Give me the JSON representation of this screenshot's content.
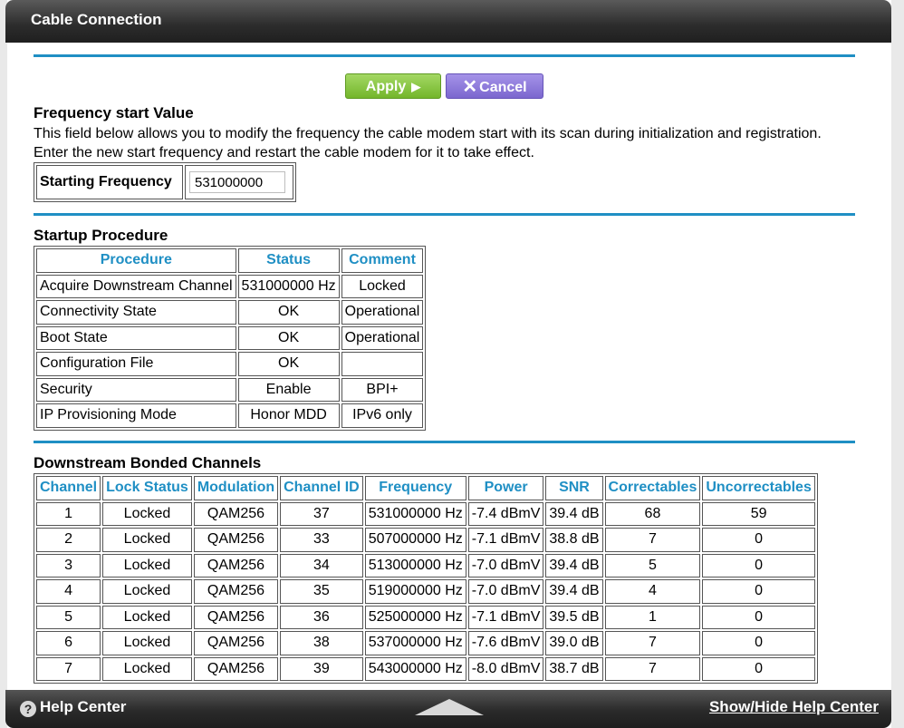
{
  "window": {
    "title": "Cable Connection"
  },
  "buttons": {
    "apply": "Apply",
    "cancel": "Cancel"
  },
  "frequency": {
    "heading": "Frequency start Value",
    "description": "This field below allows you to modify the frequency the cable modem start with its scan during initialization and registration. Enter the new start frequency and restart the cable modem for it to take effect.",
    "label": "Starting Frequency",
    "value": "531000000"
  },
  "startup": {
    "heading": "Startup Procedure",
    "columns": [
      "Procedure",
      "Status",
      "Comment"
    ],
    "rows": [
      [
        "Acquire Downstream Channel",
        "531000000 Hz",
        "Locked"
      ],
      [
        "Connectivity State",
        "OK",
        "Operational"
      ],
      [
        "Boot State",
        "OK",
        "Operational"
      ],
      [
        "Configuration File",
        "OK",
        ""
      ],
      [
        "Security",
        "Enable",
        "BPI+"
      ],
      [
        "IP Provisioning Mode",
        "Honor MDD",
        "IPv6 only"
      ]
    ]
  },
  "downstream": {
    "heading": "Downstream Bonded Channels",
    "columns": [
      "Channel",
      "Lock Status",
      "Modulation",
      "Channel ID",
      "Frequency",
      "Power",
      "SNR",
      "Correctables",
      "Uncorrectables"
    ],
    "rows": [
      [
        "1",
        "Locked",
        "QAM256",
        "37",
        "531000000 Hz",
        "-7.4 dBmV",
        "39.4 dB",
        "68",
        "59"
      ],
      [
        "2",
        "Locked",
        "QAM256",
        "33",
        "507000000 Hz",
        "-7.1 dBmV",
        "38.8 dB",
        "7",
        "0"
      ],
      [
        "3",
        "Locked",
        "QAM256",
        "34",
        "513000000 Hz",
        "-7.0 dBmV",
        "39.4 dB",
        "5",
        "0"
      ],
      [
        "4",
        "Locked",
        "QAM256",
        "35",
        "519000000 Hz",
        "-7.0 dBmV",
        "39.4 dB",
        "4",
        "0"
      ],
      [
        "5",
        "Locked",
        "QAM256",
        "36",
        "525000000 Hz",
        "-7.1 dBmV",
        "39.5 dB",
        "1",
        "0"
      ],
      [
        "6",
        "Locked",
        "QAM256",
        "38",
        "537000000 Hz",
        "-7.6 dBmV",
        "39.0 dB",
        "7",
        "0"
      ],
      [
        "7",
        "Locked",
        "QAM256",
        "39",
        "543000000 Hz",
        "-8.0 dBmV",
        "38.7 dB",
        "7",
        "0"
      ]
    ]
  },
  "footer": {
    "help_center": "Help Center",
    "toggle": "Show/Hide Help Center"
  },
  "colors": {
    "accent": "#1f8fc4",
    "apply": "#8cc63f",
    "cancel": "#8e7ddc"
  }
}
